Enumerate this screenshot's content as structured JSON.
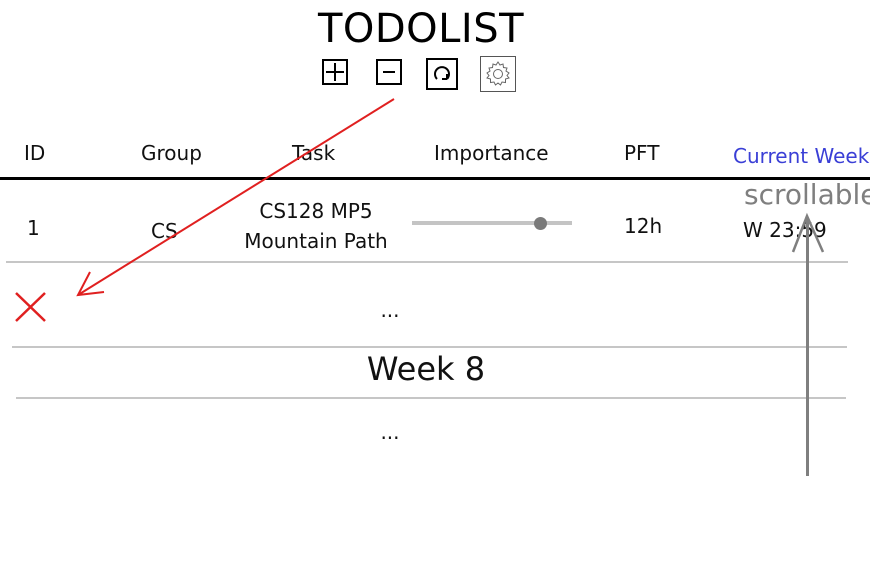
{
  "app": {
    "title": "TODOLIST"
  },
  "toolbar": {
    "icons": [
      "add-icon",
      "remove-icon",
      "refresh-icon",
      "settings-icon"
    ]
  },
  "table": {
    "columns": [
      "ID",
      "Group",
      "Task",
      "Importance",
      "PFT",
      "Current Week"
    ],
    "rows": [
      {
        "id": "1",
        "group": "CS",
        "task_line1": "CS128 MP5",
        "task_line2": "Mountain Path",
        "importance": 0.8,
        "pft": "12h",
        "due": "W 23:59"
      }
    ]
  },
  "placeholders": {
    "ellipsis_1": "...",
    "ellipsis_2": "..."
  },
  "week_divider": "Week 8",
  "annotations": {
    "scroll_note": "scrollable"
  },
  "colors": {
    "accent": "#3a3fd6",
    "delete": "#e02020",
    "separator": "#c6c6c6",
    "annotation": "#7f7f7f"
  }
}
